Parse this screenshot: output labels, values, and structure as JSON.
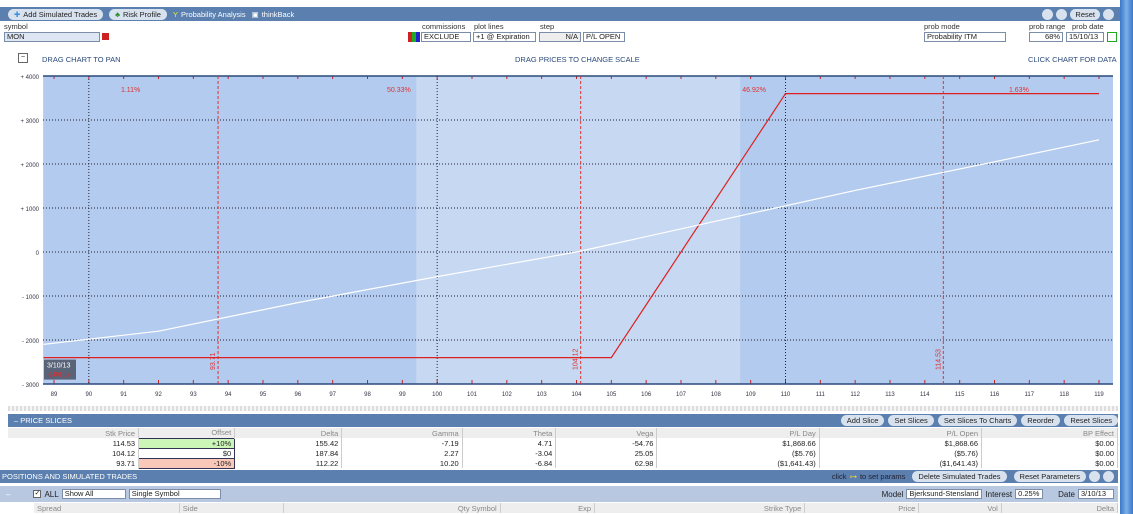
{
  "toolbar": {
    "tabs": [
      "Add Simulated Trades",
      "Risk Profile",
      "Probability Analysis",
      "thinkBack"
    ],
    "reset": "Reset"
  },
  "controls": {
    "symbol_label": "symbol",
    "symbol": "MON",
    "commissions_label": "commissions",
    "commissions": "EXCLUDE",
    "plot_lines_label": "plot lines",
    "plot_lines": "+1 @ Expiration",
    "step_label": "step",
    "step": "N/A",
    "pl_mode": "P/L OPEN",
    "prob_mode_label": "prob mode",
    "prob_mode": "Probability ITM",
    "prob_range_label": "prob range",
    "prob_range": "68%",
    "prob_date_label": "prob date",
    "prob_date": "15/10/13"
  },
  "hints": {
    "pan": "DRAG CHART TO PAN",
    "scale": "DRAG PRICES TO CHANGE SCALE",
    "data": "CLICK CHART FOR DATA"
  },
  "chart_data": {
    "type": "line",
    "xlim": [
      88.7,
      119.8
    ],
    "ylim": [
      -3000,
      4000
    ],
    "x_ticks": [
      89,
      90,
      91,
      92,
      93,
      94,
      95,
      96,
      97,
      98,
      99,
      100,
      101,
      102,
      103,
      104,
      105,
      106,
      107,
      108,
      109,
      110,
      111,
      112,
      113,
      114,
      115,
      116,
      117,
      118,
      119
    ],
    "y_ticks": [
      {
        "v": 4000,
        "t": "+ 4000"
      },
      {
        "v": 3000,
        "t": "+ 3000"
      },
      {
        "v": 2000,
        "t": "+ 2000"
      },
      {
        "v": 1000,
        "t": "+ 1000"
      },
      {
        "v": 0,
        "t": "0"
      },
      {
        "v": -1000,
        "t": "- 1000"
      },
      {
        "v": -2000,
        "t": "- 2000"
      },
      {
        "v": -3000,
        "t": "- 3000"
      }
    ],
    "series": [
      {
        "name": "expiration",
        "color": "#e02020",
        "points": [
          [
            88.7,
            -2400
          ],
          [
            105,
            -2400
          ],
          [
            110,
            3600
          ],
          [
            119,
            3600
          ]
        ]
      },
      {
        "name": "today",
        "color": "#ffffff",
        "points": [
          [
            88.7,
            -2100
          ],
          [
            92,
            -1800
          ],
          [
            96,
            -1150
          ],
          [
            100,
            -560
          ],
          [
            104,
            0
          ],
          [
            108,
            700
          ],
          [
            112,
            1400
          ],
          [
            116,
            2050
          ],
          [
            119,
            2550
          ]
        ]
      }
    ],
    "slices": [
      {
        "v": 93.71,
        "t": "93.71"
      },
      {
        "v": 104.12,
        "t": "104.12"
      },
      {
        "v": 114.53,
        "t": "114.53"
      }
    ],
    "shaded": [
      [
        88.7,
        99.4
      ],
      [
        108.7,
        119.8
      ]
    ],
    "probabilities": [
      {
        "x": 91.2,
        "t": "1.11%"
      },
      {
        "x": 98.9,
        "t": "50.33%"
      },
      {
        "x": 109.1,
        "t": "46.92%"
      },
      {
        "x": 116.7,
        "t": "1.63%"
      }
    ],
    "cursor": {
      "date": "3/10/13",
      "value": "-2401.14"
    }
  },
  "price_slices": {
    "title": "PRICE SLICES",
    "buttons": [
      "Add Slice",
      "Set Slices",
      "Set Slices To Charts",
      "Reorder",
      "Reset Slices"
    ],
    "columns": [
      "Stk Price",
      "Offset",
      "Delta",
      "Gamma",
      "Theta",
      "Vega",
      "P/L Day",
      "P/L Open",
      "BP Effect"
    ],
    "rows": [
      [
        "114.53",
        "+10%",
        "155.42",
        "-7.19",
        "4.71",
        "-54.76",
        "$1,868.66",
        "$1,868.66",
        "$0.00"
      ],
      [
        "104.12",
        "$0",
        "187.84",
        "2.27",
        "-3.04",
        "25.05",
        "($5.76)",
        "($5.76)",
        "$0.00"
      ],
      [
        "93.71",
        "-10%",
        "112.22",
        "10.20",
        "-6.84",
        "62.98",
        "($1,641.43)",
        "($1,641.43)",
        "$0.00"
      ]
    ],
    "row_colors": [
      "#ccf5b8",
      "#ffffff",
      "#f9c8b8"
    ]
  },
  "positions": {
    "title": "POSITIONS AND SIMULATED TRADES",
    "click_hint": "click",
    "click_hint2": "to set params",
    "delete": "Delete Simulated Trades",
    "reset": "Reset Parameters",
    "all": "ALL",
    "show": "Show All",
    "mode": "Single Symbol",
    "model_label": "Model",
    "model": "Bjerksund-Stensland",
    "interest_label": "Interest",
    "interest": "0.25%",
    "date_label": "Date",
    "date": "3/10/13",
    "columns": [
      "Spread",
      "Side",
      "Qty Symbol",
      "Exp",
      "Strike Type",
      "Price",
      "Vol",
      "Delta"
    ]
  }
}
